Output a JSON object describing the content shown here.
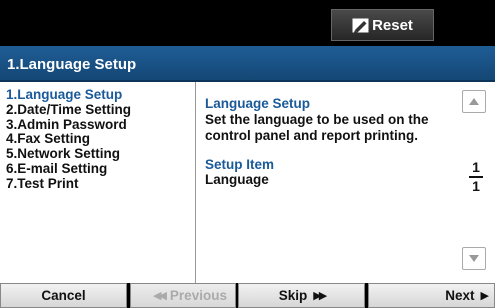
{
  "header": {
    "reset_label": "Reset",
    "reset_icon": "pencil-eraser-icon"
  },
  "title": "1.Language Setup",
  "menu": {
    "items": [
      {
        "label": "1.Language Setup",
        "selected": true
      },
      {
        "label": "2.Date/Time Setting",
        "selected": false
      },
      {
        "label": "3.Admin Password",
        "selected": false
      },
      {
        "label": "4.Fax Setting",
        "selected": false
      },
      {
        "label": "5.Network Setting",
        "selected": false
      },
      {
        "label": "6.E-mail Setting",
        "selected": false
      },
      {
        "label": "7.Test Print",
        "selected": false
      }
    ]
  },
  "description": {
    "heading": "Language Setup",
    "lines": [
      "Set the language to be used on the",
      "control panel and report printing."
    ],
    "setup_item_heading": "Setup Item",
    "setup_item_value": "Language"
  },
  "pager": {
    "current": "1",
    "total": "1"
  },
  "footer": {
    "cancel_label": "Cancel",
    "previous_label": "Previous",
    "skip_label": "Skip",
    "next_label": "Next"
  },
  "colors": {
    "title_bar": "#1f5d96",
    "selected_text": "#1a5a99",
    "disabled_text": "#aaaaaa"
  }
}
